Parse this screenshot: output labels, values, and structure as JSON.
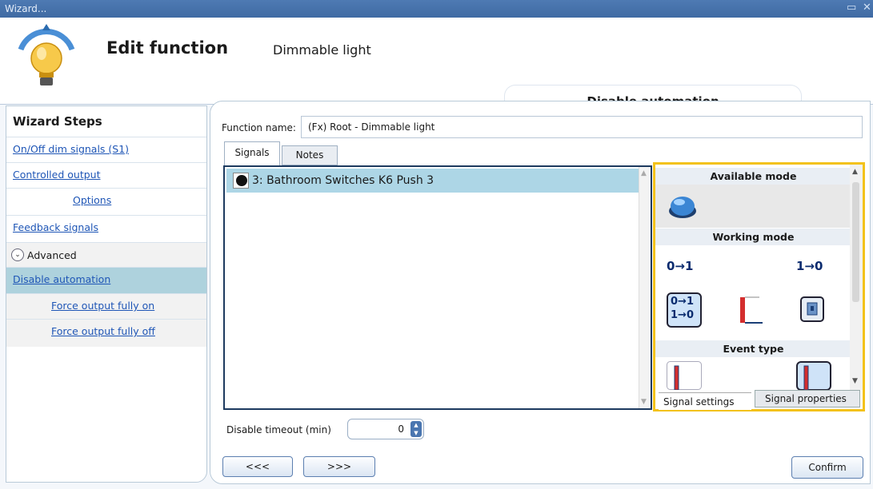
{
  "window": {
    "title": "Wizard...",
    "restore_glyph": "▭",
    "close_glyph": "✕"
  },
  "header": {
    "title": "Edit function",
    "subtitle": "Dimmable light",
    "current_step": "Disable automation"
  },
  "sidebar": {
    "heading": "Wizard Steps",
    "items": [
      {
        "label": "On/Off dim signals (S1)"
      },
      {
        "label": "Controlled output"
      },
      {
        "label": "Options"
      },
      {
        "label": "Feedback signals"
      },
      {
        "label": "Advanced"
      },
      {
        "label": "Disable automation"
      },
      {
        "label": "Force output fully on"
      },
      {
        "label": "Force output fully off"
      }
    ]
  },
  "form": {
    "function_name_label": "Function name:",
    "function_name_value": "(Fx) Root - Dimmable light"
  },
  "tabs": [
    {
      "label": "Signals"
    },
    {
      "label": "Notes"
    }
  ],
  "signals": [
    {
      "label": "3: Bathroom Switches K6 Push 3",
      "icon": "push-button-icon"
    }
  ],
  "panel": {
    "available_mode": "Available mode",
    "working_mode": "Working mode",
    "event_type": "Event type",
    "tabs": [
      {
        "label": "Signal settings"
      },
      {
        "label": "Signal properties"
      }
    ],
    "icons": {
      "rise": "0→1",
      "fall": "1→0",
      "both_top": "0→1",
      "both_bottom": "1→0"
    }
  },
  "timeout": {
    "label": "Disable timeout (min)",
    "value": "0"
  },
  "footer": {
    "prev": "<<<",
    "next": ">>>",
    "confirm": "Confirm"
  },
  "colors": {
    "accent": "#f3c21b",
    "selection": "#add6e6",
    "title_bar": "#4e7ab3"
  }
}
